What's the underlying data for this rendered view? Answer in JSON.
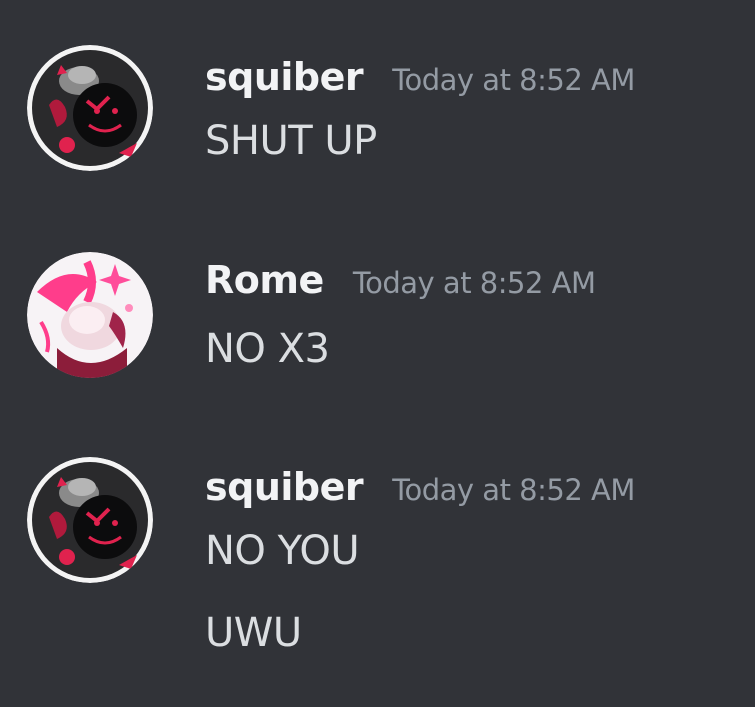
{
  "messages": [
    {
      "username": "squiber",
      "timestamp": "Today at 8:52 AM",
      "avatar_icon": "squiber-avatar",
      "lines": [
        "SHUT UP"
      ]
    },
    {
      "username": "Rome",
      "timestamp": "Today at 8:52 AM",
      "avatar_icon": "rome-avatar",
      "lines": [
        "NO X3"
      ]
    },
    {
      "username": "squiber",
      "timestamp": "Today at 8:52 AM",
      "avatar_icon": "squiber-avatar",
      "lines": [
        "NO YOU",
        "UWU"
      ]
    }
  ],
  "colors": {
    "background": "#313338",
    "username": "#f2f3f5",
    "timestamp": "#949ba4",
    "message_text": "#dbdee1",
    "avatar_accent": "#e0224e",
    "rome_accent": "#ff3d8b"
  }
}
